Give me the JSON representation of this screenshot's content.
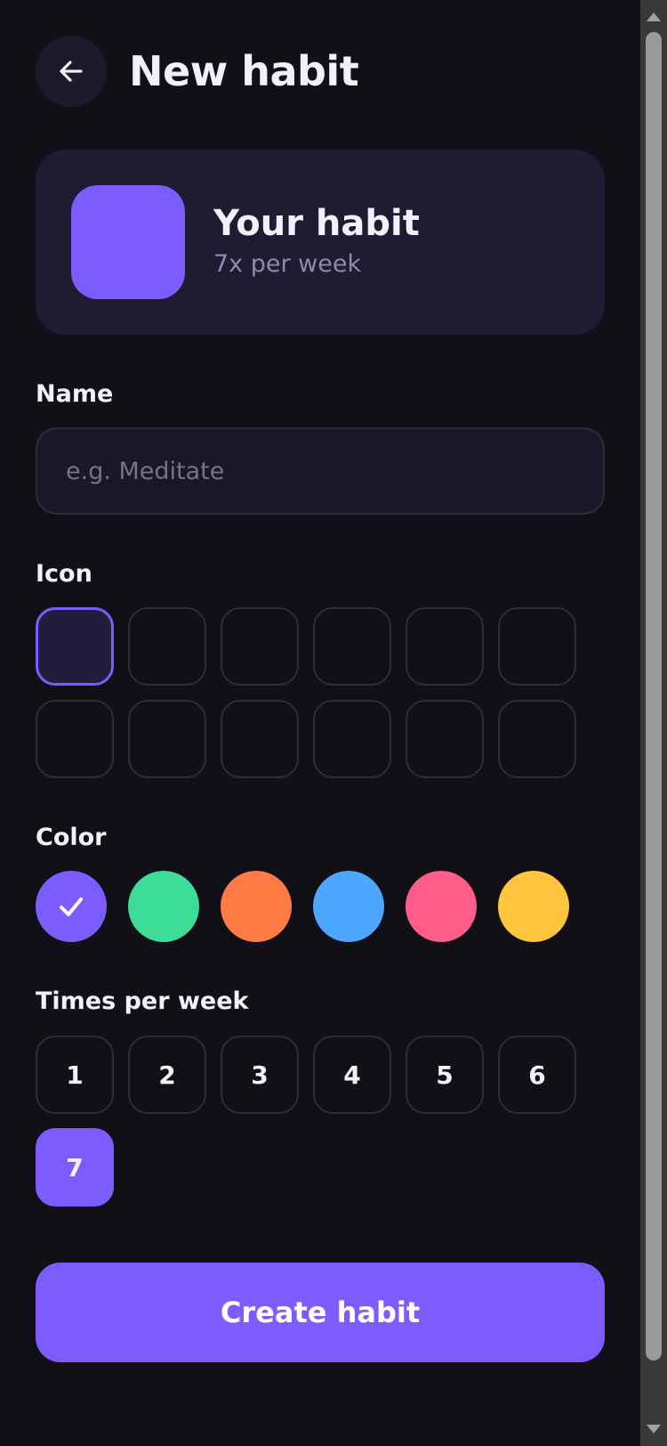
{
  "header": {
    "title": "New habit",
    "back_icon": "arrow-left-icon"
  },
  "preview": {
    "name": "Your habit",
    "frequency": "7x per week",
    "color": "#7c5cfc"
  },
  "name_section": {
    "label": "Name",
    "value": "",
    "placeholder": "e.g. Meditate"
  },
  "icon_section": {
    "label": "Icon",
    "selected_index": 0,
    "icon_count": 12
  },
  "color_section": {
    "label": "Color",
    "selected_index": 0,
    "selected_icon": "check-icon",
    "colors": [
      "#7c5cfc",
      "#3ddc97",
      "#ff7a45",
      "#4da6ff",
      "#ff5c8a",
      "#ffc53d"
    ]
  },
  "times_section": {
    "label": "Times per week",
    "options": [
      "1",
      "2",
      "3",
      "4",
      "5",
      "6",
      "7"
    ],
    "selected": "7"
  },
  "actions": {
    "create_label": "Create habit"
  },
  "theme": {
    "accent": "#7c5cfc",
    "background": "#111017",
    "card": "#1e1b33"
  }
}
